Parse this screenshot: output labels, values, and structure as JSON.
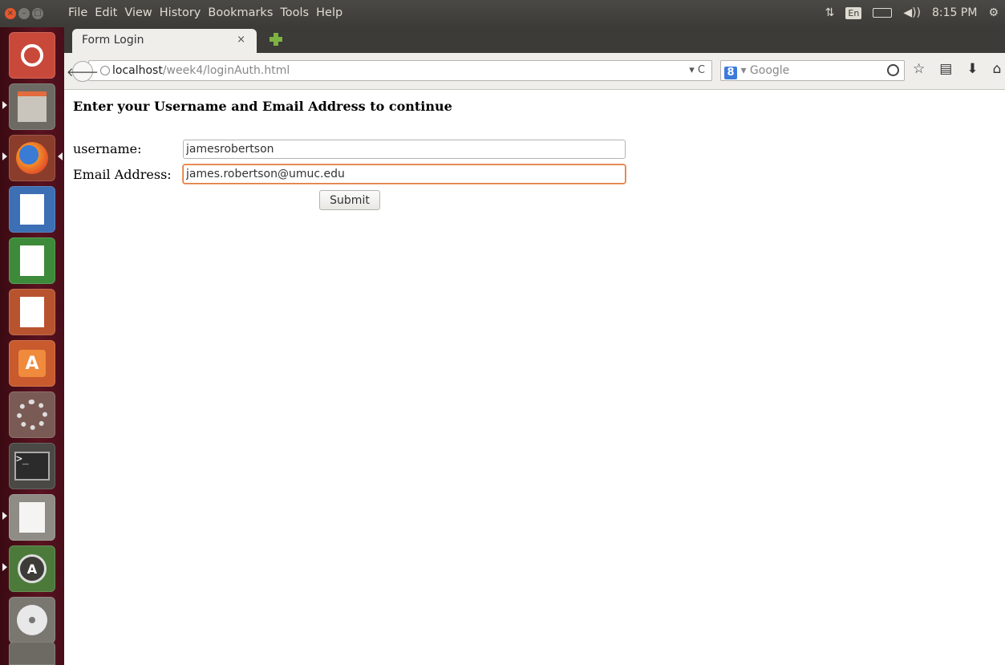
{
  "system": {
    "menus": [
      "File",
      "Edit",
      "View",
      "History",
      "Bookmarks",
      "Tools",
      "Help"
    ],
    "keyboard_layout": "En",
    "clock": "8:15 PM"
  },
  "launcher": {
    "items": [
      "ubuntu-dash-icon",
      "files-icon",
      "firefox-icon",
      "libreoffice-writer-icon",
      "libreoffice-calc-icon",
      "libreoffice-impress-icon",
      "software-center-icon",
      "system-settings-icon",
      "terminal-icon",
      "text-editor-icon",
      "software-updater-icon",
      "dvd-icon",
      "trash-icon"
    ]
  },
  "browser": {
    "tab_title": "Form Login",
    "tab_close": "×",
    "url_host": "localhost",
    "url_path": "/week4/loginAuth.html",
    "url_controls": "▾ C",
    "search_engine_badge": "8",
    "search_placeholder": "▾ Google"
  },
  "page": {
    "heading": "Enter your Username and Email Address to continue",
    "username_label": "username:",
    "username_value": "jamesrobertson",
    "email_label": "Email Address:",
    "email_value": "james.robertson@umuc.edu",
    "submit_label": "Submit"
  },
  "colors": {
    "launcher": "#5a1220",
    "panel": "#3c3b37",
    "focus_ring": "#e07a3a"
  }
}
